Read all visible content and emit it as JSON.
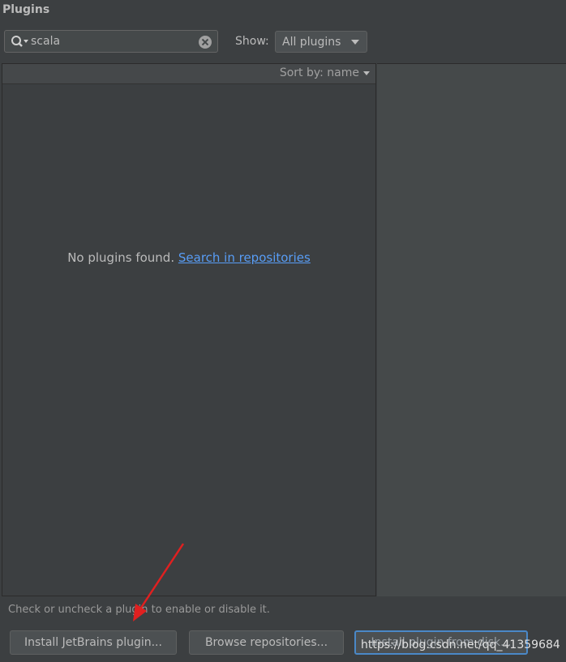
{
  "header": {
    "title": "Plugins"
  },
  "search": {
    "value": "scala",
    "search_icon": "search-icon",
    "clear_icon": "clear-icon"
  },
  "filter": {
    "label": "Show:",
    "selected": "All plugins"
  },
  "list": {
    "sort_label": "Sort by: name",
    "empty_text": "No plugins found.",
    "empty_link": "Search in repositories"
  },
  "footer": {
    "hint": "Check or uncheck a plugin to enable or disable it.",
    "buttons": {
      "install_jetbrains": "Install JetBrains plugin...",
      "browse_repositories": "Browse repositories...",
      "install_from_disk": "Install plugin from disk..."
    }
  },
  "watermark": "https://blog.csdn.net/qq_41359684",
  "colors": {
    "background": "#3c3f41",
    "link": "#589df6",
    "focus": "#4a88c7",
    "annotation_arrow": "#e02020"
  }
}
